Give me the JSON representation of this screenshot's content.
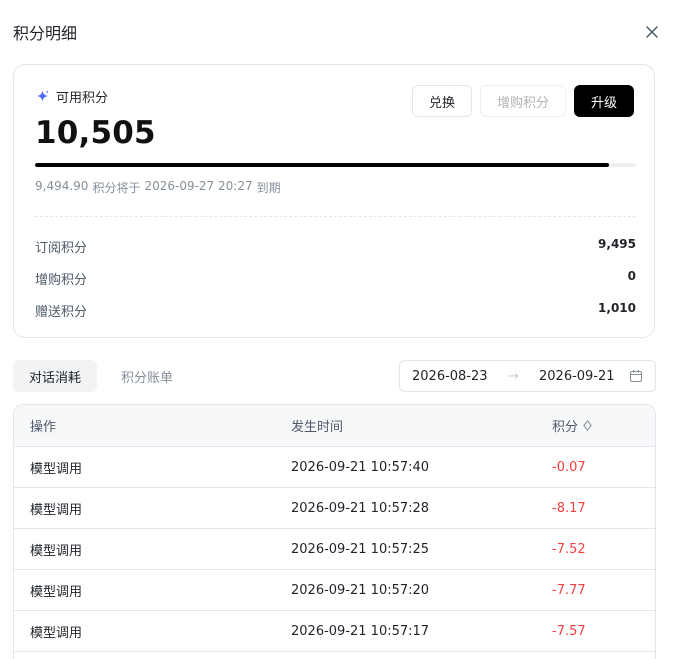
{
  "dialog": {
    "title": "积分明细"
  },
  "balance": {
    "label": "可用积分",
    "value": "10,505",
    "progress_fraction": 0.955,
    "expire": {
      "amount": "9,494.90",
      "text1": "积分将于",
      "date": "2026-09-27 20:27",
      "text2": "到期"
    }
  },
  "buttons": {
    "exchange": "兑换",
    "buy": "增购积分",
    "upgrade": "升级"
  },
  "breakdown": [
    {
      "label": "订阅积分",
      "value": "9,495"
    },
    {
      "label": "增购积分",
      "value": "0"
    },
    {
      "label": "赠送积分",
      "value": "1,010"
    }
  ],
  "tabs": [
    {
      "label": "对话消耗",
      "active": true
    },
    {
      "label": "积分账单",
      "active": false
    }
  ],
  "date_range": {
    "start": "2026-08-23",
    "separator": "→",
    "end": "2026-09-21"
  },
  "table": {
    "headers": {
      "action": "操作",
      "time": "发生时间",
      "points": "积分"
    },
    "rows": [
      {
        "action": "模型调用",
        "time": "2026-09-21 10:57:40",
        "points": "-0.07"
      },
      {
        "action": "模型调用",
        "time": "2026-09-21 10:57:28",
        "points": "-8.17"
      },
      {
        "action": "模型调用",
        "time": "2026-09-21 10:57:25",
        "points": "-7.52"
      },
      {
        "action": "模型调用",
        "time": "2026-09-21 10:57:20",
        "points": "-7.77"
      },
      {
        "action": "模型调用",
        "time": "2026-09-21 10:57:17",
        "points": "-7.57"
      }
    ]
  },
  "colors": {
    "accent": "#000000",
    "negative": "#f53f3f",
    "spark": "#4f6bff"
  },
  "icons": {
    "close": "close-icon",
    "spark": "sparkle-icon",
    "calendar": "calendar-icon",
    "sort": "sort-icon"
  }
}
